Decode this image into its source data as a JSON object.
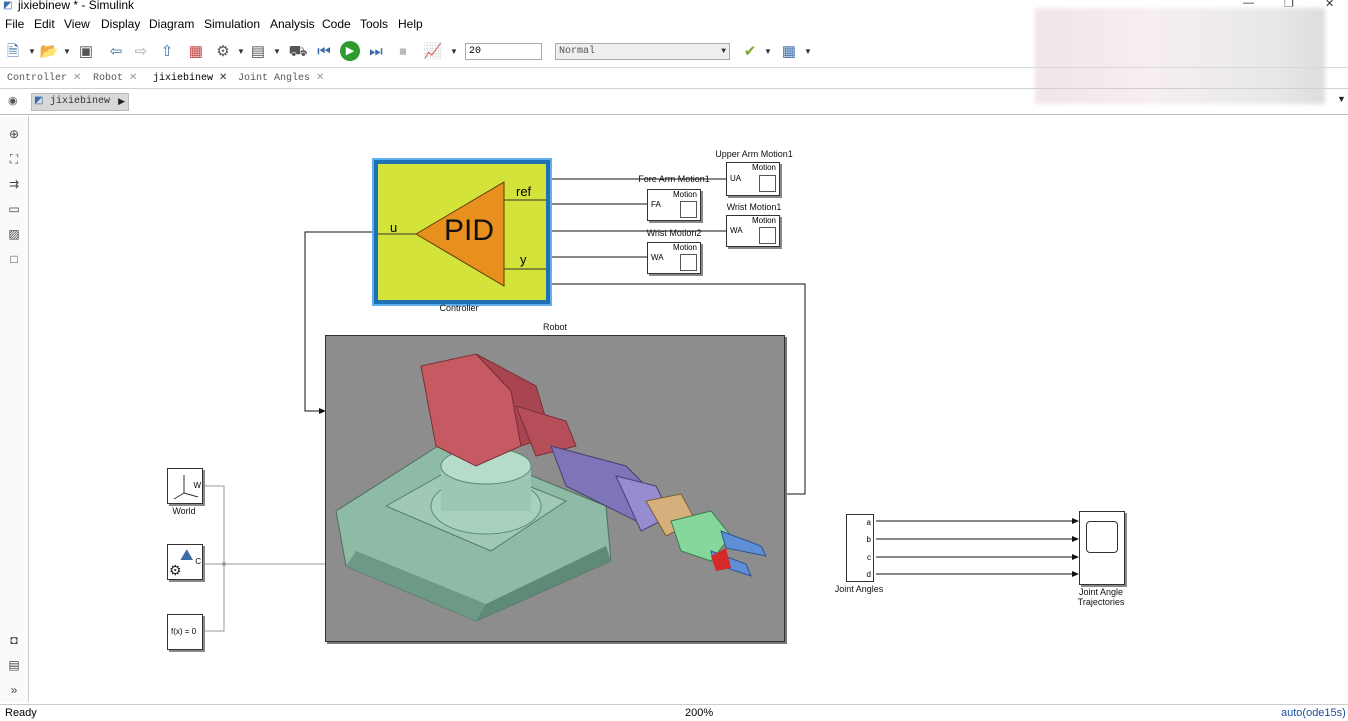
{
  "window": {
    "title": "jixiebinew * - Simulink",
    "min_glyph": "—",
    "restore_glyph": "❐",
    "close_glyph": "✕"
  },
  "menu": [
    "File",
    "Edit",
    "View",
    "Display",
    "Diagram",
    "Simulation",
    "Analysis",
    "Code",
    "Tools",
    "Help"
  ],
  "toolbar": {
    "stop_time": "20",
    "sim_mode": "Normal"
  },
  "tabs": [
    {
      "label": "Controller"
    },
    {
      "label": "Robot"
    },
    {
      "label": "jixiebinew"
    },
    {
      "label": "Joint Angles"
    }
  ],
  "breadcrumb": "jixiebinew",
  "diagram": {
    "controller": {
      "label": "Controller",
      "pid": "PID",
      "in_u": "u",
      "out_ref": "ref",
      "out_y": "y"
    },
    "robot": {
      "label": "Robot"
    },
    "motion_blocks": [
      {
        "title": "Upper Arm Motion1",
        "inner": "Motion",
        "port": "UA"
      },
      {
        "title": "Fore Arm Motion1",
        "inner": "Motion",
        "port": "FA"
      },
      {
        "title": "Wrist Motion1",
        "inner": "Motion",
        "port": "WA"
      },
      {
        "title": "Wrist Motion2",
        "inner": "Motion",
        "port": "WA"
      }
    ],
    "world": {
      "label": "World",
      "port": "W"
    },
    "solver": {
      "port": "C"
    },
    "fx": {
      "text": "f(x) = 0"
    },
    "joint_angles": {
      "label": "Joint Angles",
      "ports": [
        "a",
        "b",
        "c",
        "d"
      ]
    },
    "scope": {
      "label": "Joint Angle Trajectories"
    }
  },
  "status": {
    "left": "Ready",
    "zoom": "200%",
    "solver": "auto(ode15s)"
  },
  "colors": {
    "pid_bg": "#d4e33a",
    "pid_triangle": "#e8901e",
    "pid_frame": "#1f6fb3",
    "robot_bg": "#8d8d8d"
  }
}
